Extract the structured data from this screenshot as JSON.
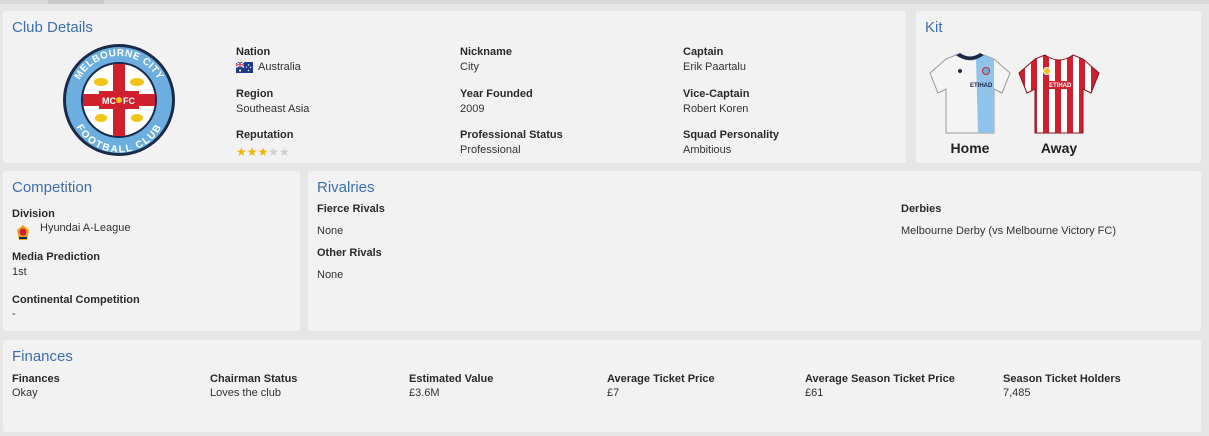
{
  "club_details": {
    "title": "Club Details",
    "badge": {
      "text_top": "MELBOURNE CITY",
      "text_bottom": "FOOTBALL CLUB",
      "mc": "MC",
      "fc": "FC"
    },
    "nation": {
      "label": "Nation",
      "value": "Australia",
      "flag_icon": "australia-flag-icon"
    },
    "region": {
      "label": "Region",
      "value": "Southeast Asia"
    },
    "reputation": {
      "label": "Reputation",
      "stars_filled": 3,
      "stars_total": 5
    },
    "nickname": {
      "label": "Nickname",
      "value": "City"
    },
    "year_founded": {
      "label": "Year Founded",
      "value": "2009"
    },
    "professional_status": {
      "label": "Professional Status",
      "value": "Professional"
    },
    "captain": {
      "label": "Captain",
      "value": "Erik Paartalu"
    },
    "vice_captain": {
      "label": "Vice-Captain",
      "value": "Robert Koren"
    },
    "squad_personality": {
      "label": "Squad Personality",
      "value": "Ambitious"
    }
  },
  "kit": {
    "title": "Kit",
    "home_label": "Home",
    "away_label": "Away",
    "sponsor_text": "ETIHAD",
    "colors": {
      "home_main": "#ffffff",
      "home_stripe": "#8fc3ea",
      "away_main": "#d0202e",
      "away_stripe": "#ffffff"
    }
  },
  "competition": {
    "title": "Competition",
    "division": {
      "label": "Division",
      "value": "Hyundai A-League",
      "icon": "a-league-logo-icon"
    },
    "media_prediction": {
      "label": "Media Prediction",
      "value": "1st"
    },
    "continental": {
      "label": "Continental Competition",
      "value": "-"
    }
  },
  "rivalries": {
    "title": "Rivalries",
    "fierce": {
      "label": "Fierce Rivals",
      "value": "None"
    },
    "other": {
      "label": "Other Rivals",
      "value": "None"
    },
    "derbies": {
      "label": "Derbies",
      "value": "Melbourne Derby (vs Melbourne Victory FC)"
    }
  },
  "finances": {
    "title": "Finances",
    "items": [
      {
        "label": "Finances",
        "value": "Okay"
      },
      {
        "label": "Chairman Status",
        "value": "Loves the club"
      },
      {
        "label": "Estimated Value",
        "value": "£3.6M"
      },
      {
        "label": "Average Ticket Price",
        "value": "£7"
      },
      {
        "label": "Average Season Ticket Price",
        "value": "£61"
      },
      {
        "label": "Season Ticket Holders",
        "value": "7,485"
      }
    ]
  },
  "theme": {
    "accent": "#3d6fb0",
    "star_on": "#f0b400",
    "star_off": "#cfcfcf",
    "badge_blue": "#6caee0",
    "badge_navy": "#1b2a4a",
    "badge_red": "#d0202e"
  }
}
